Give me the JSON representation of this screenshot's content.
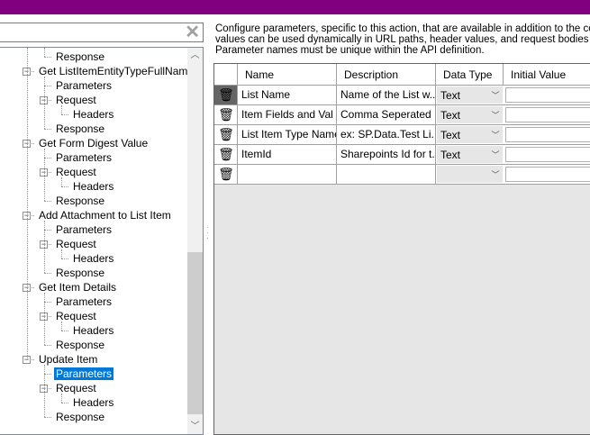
{
  "search": {
    "value": "",
    "placeholder": ""
  },
  "tree": [
    {
      "label": "Response",
      "level": 2
    },
    {
      "label": "Get ListItemEntityTypeFullName",
      "level": 1,
      "expanded": true
    },
    {
      "label": "Parameters",
      "level": 2
    },
    {
      "label": "Request",
      "level": 2,
      "expanded": true
    },
    {
      "label": "Headers",
      "level": 3
    },
    {
      "label": "Response",
      "level": 2
    },
    {
      "label": "Get Form Digest Value",
      "level": 1,
      "expanded": true
    },
    {
      "label": "Parameters",
      "level": 2
    },
    {
      "label": "Request",
      "level": 2,
      "expanded": true
    },
    {
      "label": "Headers",
      "level": 3
    },
    {
      "label": "Response",
      "level": 2
    },
    {
      "label": "Add Attachment to List Item",
      "level": 1,
      "expanded": true
    },
    {
      "label": "Parameters",
      "level": 2
    },
    {
      "label": "Request",
      "level": 2,
      "expanded": true
    },
    {
      "label": "Headers",
      "level": 3
    },
    {
      "label": "Response",
      "level": 2
    },
    {
      "label": "Get Item Details",
      "level": 1,
      "expanded": true
    },
    {
      "label": "Parameters",
      "level": 2
    },
    {
      "label": "Request",
      "level": 2,
      "expanded": true
    },
    {
      "label": "Headers",
      "level": 3
    },
    {
      "label": "Response",
      "level": 2
    },
    {
      "label": "Update Item",
      "level": 1,
      "expanded": true
    },
    {
      "label": "Parameters",
      "level": 2,
      "selected": true
    },
    {
      "label": "Request",
      "level": 2,
      "expanded": true
    },
    {
      "label": "Headers",
      "level": 3
    },
    {
      "label": "Response",
      "level": 2
    }
  ],
  "description": [
    "Configure parameters, specific to this action, that are available in addition to the com",
    "values can be used dynamically in URL paths, header values, and request bodies wh",
    "Parameter names must be unique within the API definition."
  ],
  "grid": {
    "columns": [
      "Name",
      "Description",
      "Data Type",
      "Initial Value"
    ],
    "rows": [
      {
        "name": "List Name",
        "description": "Name of the List w...",
        "type": "Text",
        "initial": ""
      },
      {
        "name": "Item Fields and Val",
        "description": "Comma Seperated ...",
        "type": "Text",
        "initial": ""
      },
      {
        "name": "List Item Type Name",
        "description": "ex: SP.Data.Test Li...",
        "type": "Text",
        "initial": ""
      },
      {
        "name": "ItemId",
        "description": "Sharepoints Id for t...",
        "type": "Text",
        "initial": ""
      },
      {
        "name": "",
        "description": "",
        "type": "",
        "initial": ""
      }
    ]
  },
  "colors": {
    "titlebar": "#80007f",
    "selection": "#0078d7"
  }
}
